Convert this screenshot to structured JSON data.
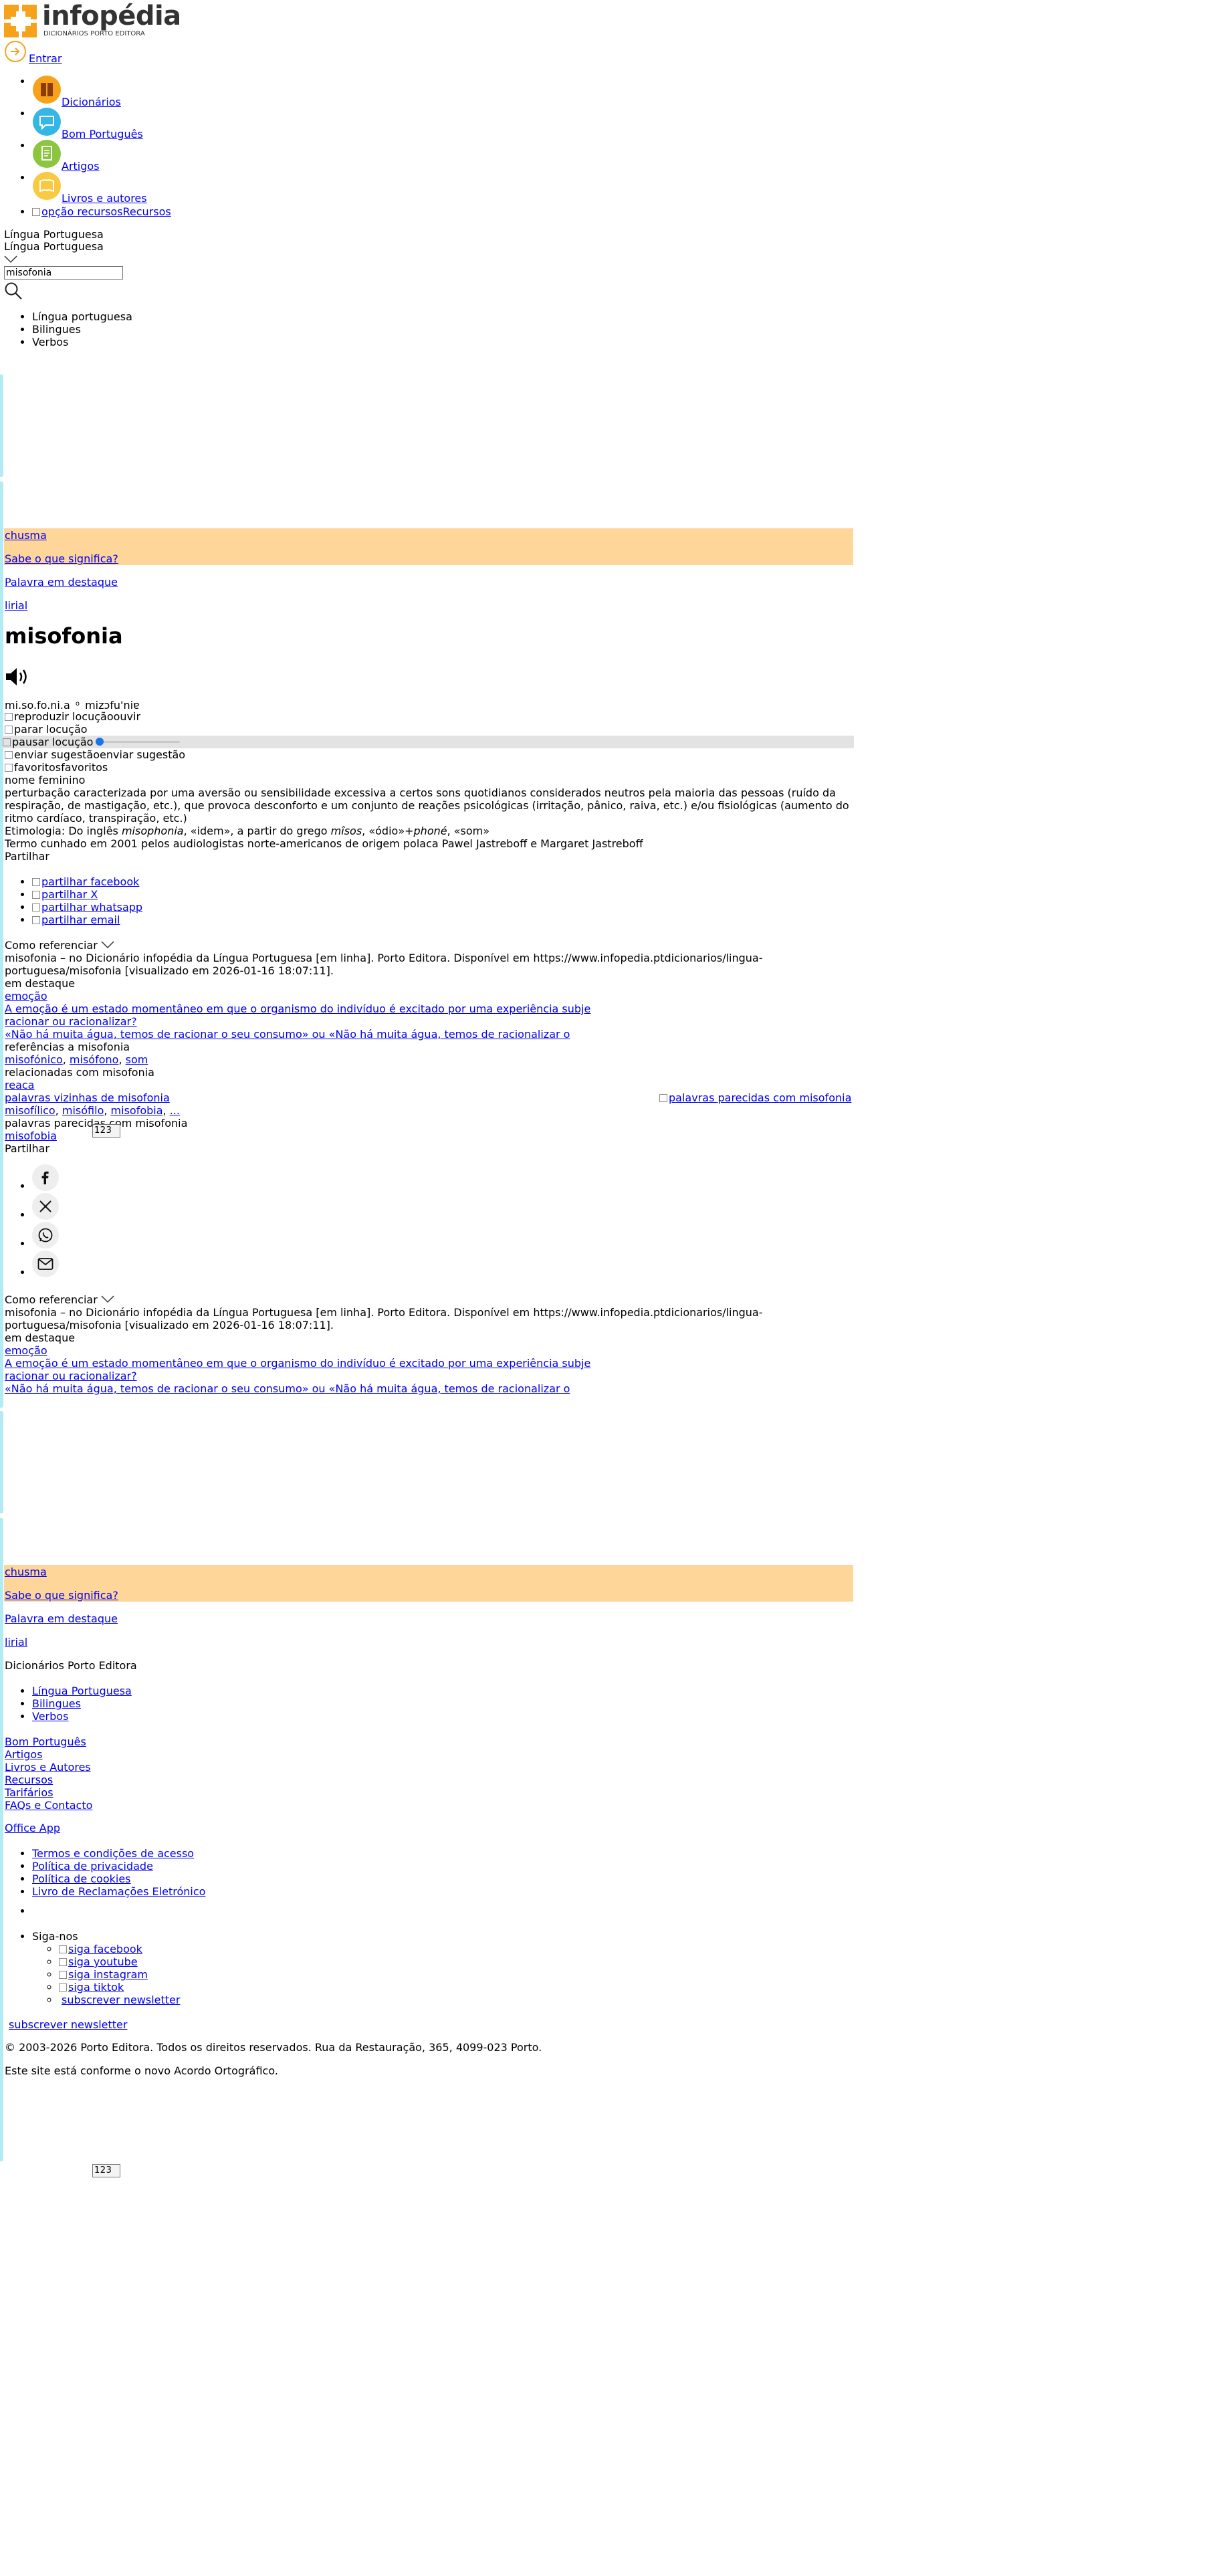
{
  "brand": {
    "name": "infopédia",
    "tagline": "DICIONÁRIOS PORTO EDITORA",
    "orange": "#f7a21b",
    "teal": "#b2ebf2",
    "highlight": "#ffd699"
  },
  "login": {
    "label": "Entrar"
  },
  "nav": [
    {
      "label": "Dicionários",
      "icon": "books-icon",
      "color": "#f7a21b"
    },
    {
      "label": "Bom Português",
      "icon": "speech-icon",
      "color": "#35b7e6"
    },
    {
      "label": "Artigos",
      "icon": "article-icon",
      "color": "#8cc63f"
    },
    {
      "label": "Livros e autores",
      "icon": "book-icon",
      "color": "#f9c941"
    },
    {
      "label": "Recursos",
      "alt": "opção recursos"
    }
  ],
  "search": {
    "dictionary": "Língua Portuguesa",
    "dictionary_selected": "Língua Portuguesa",
    "value": "misofonia",
    "options": [
      "Língua portuguesa",
      "Bilingues",
      "Verbos"
    ]
  },
  "promo": [
    {
      "word": "chusma",
      "question": "Sabe o que significa?"
    },
    {
      "word": "lirial",
      "label": "Palavra em destaque"
    }
  ],
  "entry": {
    "headword": "misofonia",
    "syllables": "mi.so.fo.ni.a",
    "ipa": "mizɔfu'niɐ",
    "audio": {
      "play_alt": "reproduzir locução",
      "play_label": "ouvir",
      "stop_alt": "parar locução",
      "pause_alt": "pausar locução",
      "progress": 0
    },
    "suggest_alt": "enviar sugestão",
    "suggest_label": "enviar sugestão",
    "fav_alt": "favoritos",
    "fav_label": "favoritos",
    "grammar": "nome feminino",
    "definition": "perturbação caracterizada por uma aversão ou sensibilidade excessiva a certos sons quotidianos considerados neutros pela maioria das pessoas (ruído da respiração, de mastigação, etc.), que provoca desconforto e um conjunto de reações psicológicas (irritação, pânico, raiva, etc.) e/ou fisiológicas (aumento do ritmo cardíaco, transpiração, etc.)",
    "etym": {
      "p1": "Etimologia: Do inglês ",
      "i1": "misophonia",
      "p2": ", «idem», a partir do grego ",
      "i2": "mîsos",
      "p3": ", «ódio»+",
      "i3": "phoné",
      "p4": ", «som»"
    },
    "note": "Termo cunhado em 2001 pelos audiologistas norte-americanos de origem polaca Pawel Jastreboff e Margaret Jastreboff"
  },
  "share": {
    "label": "Partilhar",
    "items": [
      "partilhar facebook",
      "partilhar X",
      "partilhar whatsapp",
      "partilhar email"
    ]
  },
  "cite": {
    "label": "Como referenciar",
    "text": "misofonia – no Dicionário infopédia da Língua Portuguesa [em linha]. Porto Editora. Disponível em https://www.infopedia.ptdicionarios/lingua-portuguesa/misofonia [visualizado em 2026-01-16 18:07:11]."
  },
  "featured": {
    "label": "em destaque",
    "word": "emoção",
    "links": [
      "A emoção é um estado momentâneo em que o organismo do indivíduo é excitado por uma experiência subje",
      "racionar ou racionalizar?",
      "«Não há muita água, temos de racionar o seu consumo» ou «Não há muita água, temos de racionalizar o"
    ]
  },
  "refs": {
    "label": "referências a misofonia",
    "items": [
      "misofónico",
      "misófono",
      "som"
    ]
  },
  "related": {
    "label": "relacionadas com misofonia",
    "items": [
      "reaca"
    ]
  },
  "neighbors": {
    "label": "palavras vizinhas de misofonia",
    "items": [
      "misofílico",
      "misófilo",
      "misofobia",
      "..."
    ],
    "image_alt": "palavras parecidas com misofonia"
  },
  "similar": {
    "label": "palavras parecidas com misofonia",
    "items": [
      "misofobia"
    ]
  },
  "pager": [
    "1",
    "2",
    "3"
  ],
  "share2": {
    "label": "Partilhar",
    "items": [
      "facebook-icon",
      "x-icon",
      "whatsapp-icon",
      "email-icon"
    ]
  },
  "footer": {
    "title": "Dicionários Porto Editora",
    "dicts": [
      "Língua Portuguesa",
      "Bilingues",
      "Verbos"
    ],
    "links": [
      "Bom Português",
      "Artigos",
      "Livros e Autores",
      "Recursos",
      "Tarifários",
      "FAQs e Contacto"
    ],
    "app": "Office App",
    "legal": [
      "Termos e condições de acesso",
      "Política de privacidade",
      "Política de cookies",
      "Livro de Reclamações Eletrónico"
    ],
    "follow_label": "Siga-nos",
    "follow": [
      "siga facebook",
      "siga youtube",
      "siga instagram",
      "siga tiktok"
    ],
    "newsletter": "subscrever newsletter",
    "copyright": "© 2003-2026 Porto Editora. Todos os direitos reservados. Rua da Restauração, 365, 4099-023 Porto.",
    "agreement": "Este site está conforme o novo Acordo Ortográfico."
  }
}
